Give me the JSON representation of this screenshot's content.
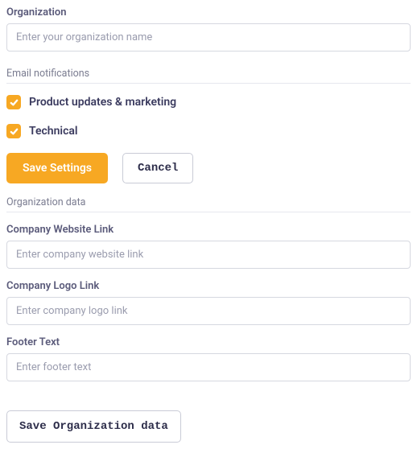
{
  "org": {
    "label": "Organization",
    "placeholder": "Enter your organization name"
  },
  "emailSection": {
    "title": "Email notifications",
    "items": [
      {
        "label": "Product updates & marketing",
        "checked": true
      },
      {
        "label": "Technical",
        "checked": true
      }
    ]
  },
  "actions": {
    "save": "Save Settings",
    "cancel": "Cancel"
  },
  "orgDataSection": {
    "title": "Organization data",
    "fields": {
      "website": {
        "label": "Company Website Link",
        "placeholder": "Enter company website link"
      },
      "logo": {
        "label": "Company Logo Link",
        "placeholder": "Enter company logo link"
      },
      "footer": {
        "label": "Footer Text",
        "placeholder": "Enter footer text"
      }
    },
    "save": "Save Organization data"
  }
}
